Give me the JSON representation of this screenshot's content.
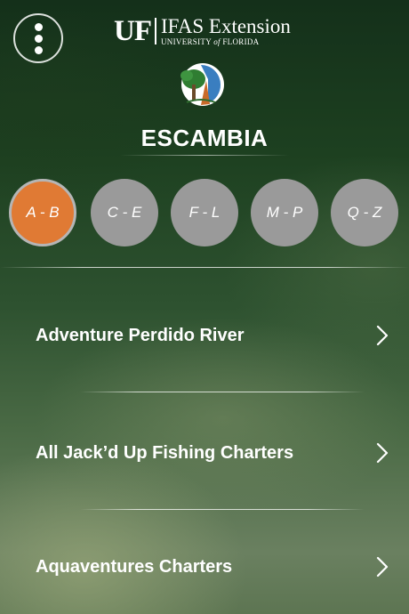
{
  "header": {
    "menu_icon": "vertical-ellipsis-icon",
    "brand": {
      "uf": "UF",
      "title": "IFAS Extension",
      "subtitle_pre": "UNIVERSITY ",
      "subtitle_of": "of",
      "subtitle_post": " FLORIDA"
    },
    "county_title": "ESCAMBIA"
  },
  "tabs": [
    {
      "label": "A - B",
      "active": true
    },
    {
      "label": "C - E",
      "active": false
    },
    {
      "label": "F - L",
      "active": false
    },
    {
      "label": "M - P",
      "active": false
    },
    {
      "label": "Q - Z",
      "active": false
    }
  ],
  "list": {
    "items": [
      {
        "label": "Adventure Perdido River"
      },
      {
        "label": "All Jack’d Up Fishing Charters"
      },
      {
        "label": "Aquaventures Charters"
      }
    ]
  },
  "colors": {
    "accent": "#e07a34",
    "tab_inactive": "#9a9a9a"
  }
}
